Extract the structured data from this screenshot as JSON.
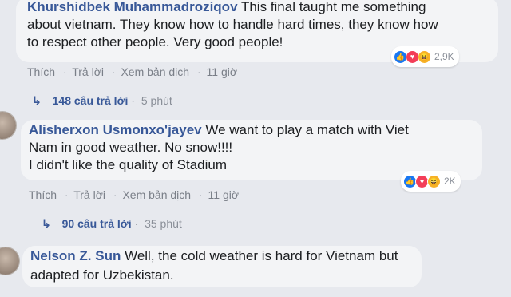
{
  "colors": {
    "author": "#385898",
    "background": "#e7e9ee",
    "bubble": "#f3f4f6",
    "like": "#1877f2",
    "love": "#f33e58",
    "haha": "#f7b125"
  },
  "actions": {
    "like": "Thích",
    "reply": "Trả lời",
    "translate": "Xem bản dịch"
  },
  "comments": [
    {
      "author": "Khurshidbek Muhammadroziqov",
      "text_lines": [
        "This final taught me something",
        "about vietnam. They know how to handle hard times, they know how",
        "to respect other people. Very good people!"
      ],
      "time": "11 giờ",
      "reaction_count": "2,9K",
      "replies_label": "148 câu trả lời",
      "replies_time": "5 phút"
    },
    {
      "author": "Alisherxon Usmonxo'jayev",
      "text_lines": [
        "We want to play a match with Viet",
        "Nam in good weather. No snow!!!!",
        "I didn't like the quality of Stadium"
      ],
      "time": "11 giờ",
      "reaction_count": "2K",
      "replies_label": "90 câu trả lời",
      "replies_time": "35 phút"
    },
    {
      "author": "Nelson Z. Sun",
      "text_lines": [
        "Well, the cold weather is hard for Vietnam but",
        "adapted for Uzbekistan."
      ]
    }
  ]
}
